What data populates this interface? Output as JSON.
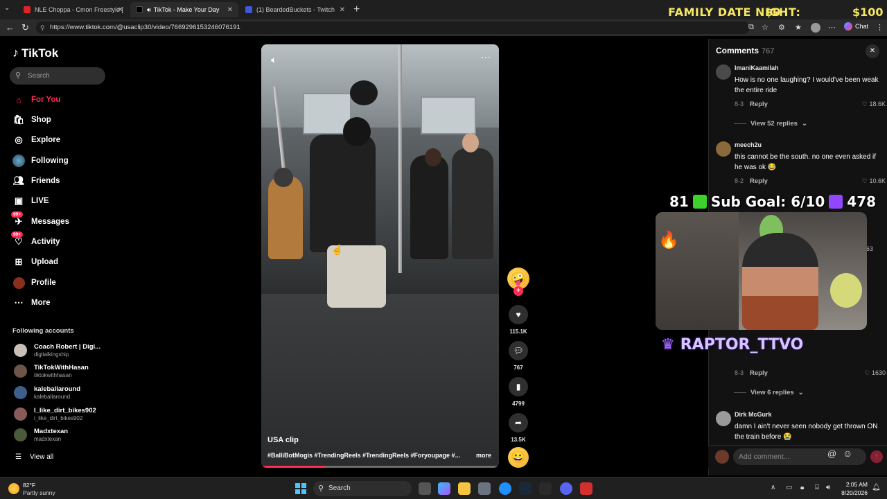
{
  "browser": {
    "tabs": [
      {
        "title": "NLE Choppa - Cmon Freestyle [Of"
      },
      {
        "title": "TikTok - Make Your Day"
      },
      {
        "title": "(1) BeardedBuckets - Twitch"
      }
    ],
    "url": "https://www.tiktok.com/@usaclip30/video/7669296153246076191",
    "chat_label": "Chat"
  },
  "overlay": {
    "family_label": "FAMILY DATE NIGHT:",
    "family_amount": "$0",
    "family_total": "$100",
    "sub_left": "81",
    "sub_goal": "Sub Goal: 6/10",
    "sub_right": "478",
    "streamer_name": "RAPTOR_TTVO"
  },
  "sidebar": {
    "logo": "TikTok",
    "search_placeholder": "Search",
    "items": [
      {
        "label": "For You",
        "icon": "home-icon"
      },
      {
        "label": "Shop",
        "icon": "shop-icon"
      },
      {
        "label": "Explore",
        "icon": "compass-icon"
      },
      {
        "label": "Following",
        "icon": "following-avatar-icon"
      },
      {
        "label": "Friends",
        "icon": "friends-icon"
      },
      {
        "label": "LIVE",
        "icon": "live-icon"
      },
      {
        "label": "Messages",
        "icon": "messages-icon",
        "badge": "99+"
      },
      {
        "label": "Activity",
        "icon": "activity-icon",
        "badge": "99+"
      },
      {
        "label": "Upload",
        "icon": "upload-icon"
      },
      {
        "label": "Profile",
        "icon": "profile-icon"
      },
      {
        "label": "More",
        "icon": "more-icon"
      }
    ],
    "following_title": "Following accounts",
    "accounts": [
      {
        "name": "Coach Robert | Digi...",
        "handle": "digitalkingship"
      },
      {
        "name": "TikTokWithHasan",
        "handle": "tiktokwithhasan"
      },
      {
        "name": "kaleballaround",
        "handle": "kaleballaround"
      },
      {
        "name": "I_like_dirt_bikes902",
        "handle": "i_like_dirt_bikes902"
      },
      {
        "name": "Madxtexan",
        "handle": "madxtexan"
      }
    ],
    "view_all": "View all"
  },
  "video": {
    "caption_title": "USA clip",
    "hashtags": "#BalliBotMogis #TrendingReels #TrendingReels #Foryoupage #...",
    "more_label": "more",
    "progress": 0.27
  },
  "actions": {
    "likes": "115.1K",
    "comments": "767",
    "saves": "4799",
    "shares": "13.5K"
  },
  "comments": {
    "title": "Comments",
    "count": "767",
    "items": [
      {
        "user": "ImaniKaamilah",
        "text": "How is no one laughing? I would've been weak the entire ride",
        "date": "8-3",
        "likes": "18.6K",
        "replies": "View 52 replies"
      },
      {
        "user": "meech2u",
        "text": "this cannot be the south. no one even asked if he was ok 😂",
        "date": "8-2",
        "likes": "10.6K"
      },
      {
        "user": "",
        "text": "",
        "date": "8-3",
        "likes": "1630",
        "replies": "View 6 replies"
      },
      {
        "user": "Dirk McGurk",
        "text": "damn I ain't never seen nobody get thrown ON the train before 😭"
      }
    ],
    "reply_label": "Reply",
    "partial_likes": "063",
    "add_placeholder": "Add comment..."
  },
  "taskbar": {
    "temp": "82°F",
    "condition": "Partly sunny",
    "search": "Search",
    "time": "2:05 AM",
    "date": "8/20/2026"
  }
}
